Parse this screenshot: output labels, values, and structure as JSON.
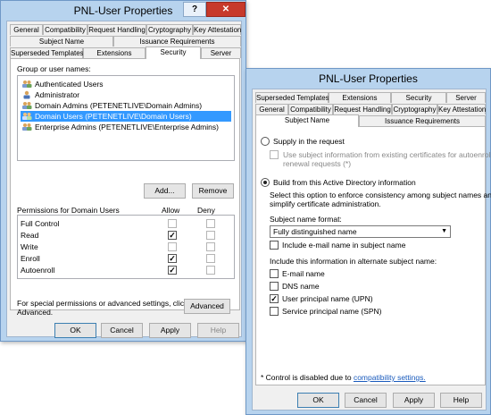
{
  "left_dialog": {
    "title": "PNL-User Properties",
    "help_glyph": "?",
    "close_glyph": "✕",
    "tabs_row1": [
      "General",
      "Compatibility",
      "Request Handling",
      "Cryptography",
      "Key Attestation"
    ],
    "tabs_row2": [
      "Subject Name",
      "Issuance Requirements"
    ],
    "tabs_row3": [
      "Superseded Templates",
      "Extensions",
      "Security",
      "Server"
    ],
    "group_label": "Group or user names:",
    "users": [
      "Authenticated Users",
      "Administrator",
      "Domain Admins (PETENETLIVE\\Domain Admins)",
      "Domain Users (PETENETLIVE\\Domain Users)",
      "Enterprise Admins (PETENETLIVE\\Enterprise Admins)"
    ],
    "selected_user_index": 3,
    "add_label": "Add...",
    "remove_label": "Remove",
    "permissions_label": "Permissions for Domain Users",
    "allow_label": "Allow",
    "deny_label": "Deny",
    "permissions": [
      {
        "name": "Full Control",
        "allow": false,
        "deny": false
      },
      {
        "name": "Read",
        "allow": true,
        "deny": false
      },
      {
        "name": "Write",
        "allow": false,
        "deny": false
      },
      {
        "name": "Enroll",
        "allow": true,
        "deny": false
      },
      {
        "name": "Autoenroll",
        "allow": true,
        "deny": false
      }
    ],
    "special_text_line1": "For special permissions or advanced settings, click",
    "special_text_line2": "Advanced.",
    "advanced_label": "Advanced",
    "ok_label": "OK",
    "cancel_label": "Cancel",
    "apply_label": "Apply",
    "help_label": "Help"
  },
  "right_dialog": {
    "title": "PNL-User Properties",
    "tabs_row1": [
      "Superseded Templates",
      "Extensions",
      "Security",
      "Server"
    ],
    "tabs_row2": [
      "General",
      "Compatibility",
      "Request Handling",
      "Cryptography",
      "Key Attestation"
    ],
    "tabs_row3": [
      "Subject Name",
      "Issuance Requirements"
    ],
    "supply_label": "Supply in the request",
    "use_subject_line1": "Use subject information from existing certificates for autoenrollment",
    "use_subject_line2": "renewal requests (*)",
    "build_label": "Build from this Active Directory information",
    "build_desc_line1": "Select this option to enforce consistency among subject names and to",
    "build_desc_line2": "simplify certificate administration.",
    "format_label": "Subject name format:",
    "format_value": "Fully distinguished name",
    "include_email_label": "Include e-mail name in subject name",
    "alt_label": "Include this information in alternate subject name:",
    "alt_options": [
      {
        "name": "E-mail name",
        "checked": false
      },
      {
        "name": "DNS name",
        "checked": false
      },
      {
        "name": "User principal name (UPN)",
        "checked": true
      },
      {
        "name": "Service principal name (SPN)",
        "checked": false
      }
    ],
    "footnote_prefix": "* Control is disabled due to ",
    "footnote_link": "compatibility settings.",
    "ok_label": "OK",
    "cancel_label": "Cancel",
    "apply_label": "Apply",
    "help_label": "Help"
  },
  "colors": {
    "frame": "#b7d3ee",
    "selection": "#3399ff",
    "close": "#c7392b",
    "link": "#1a5bbd"
  }
}
